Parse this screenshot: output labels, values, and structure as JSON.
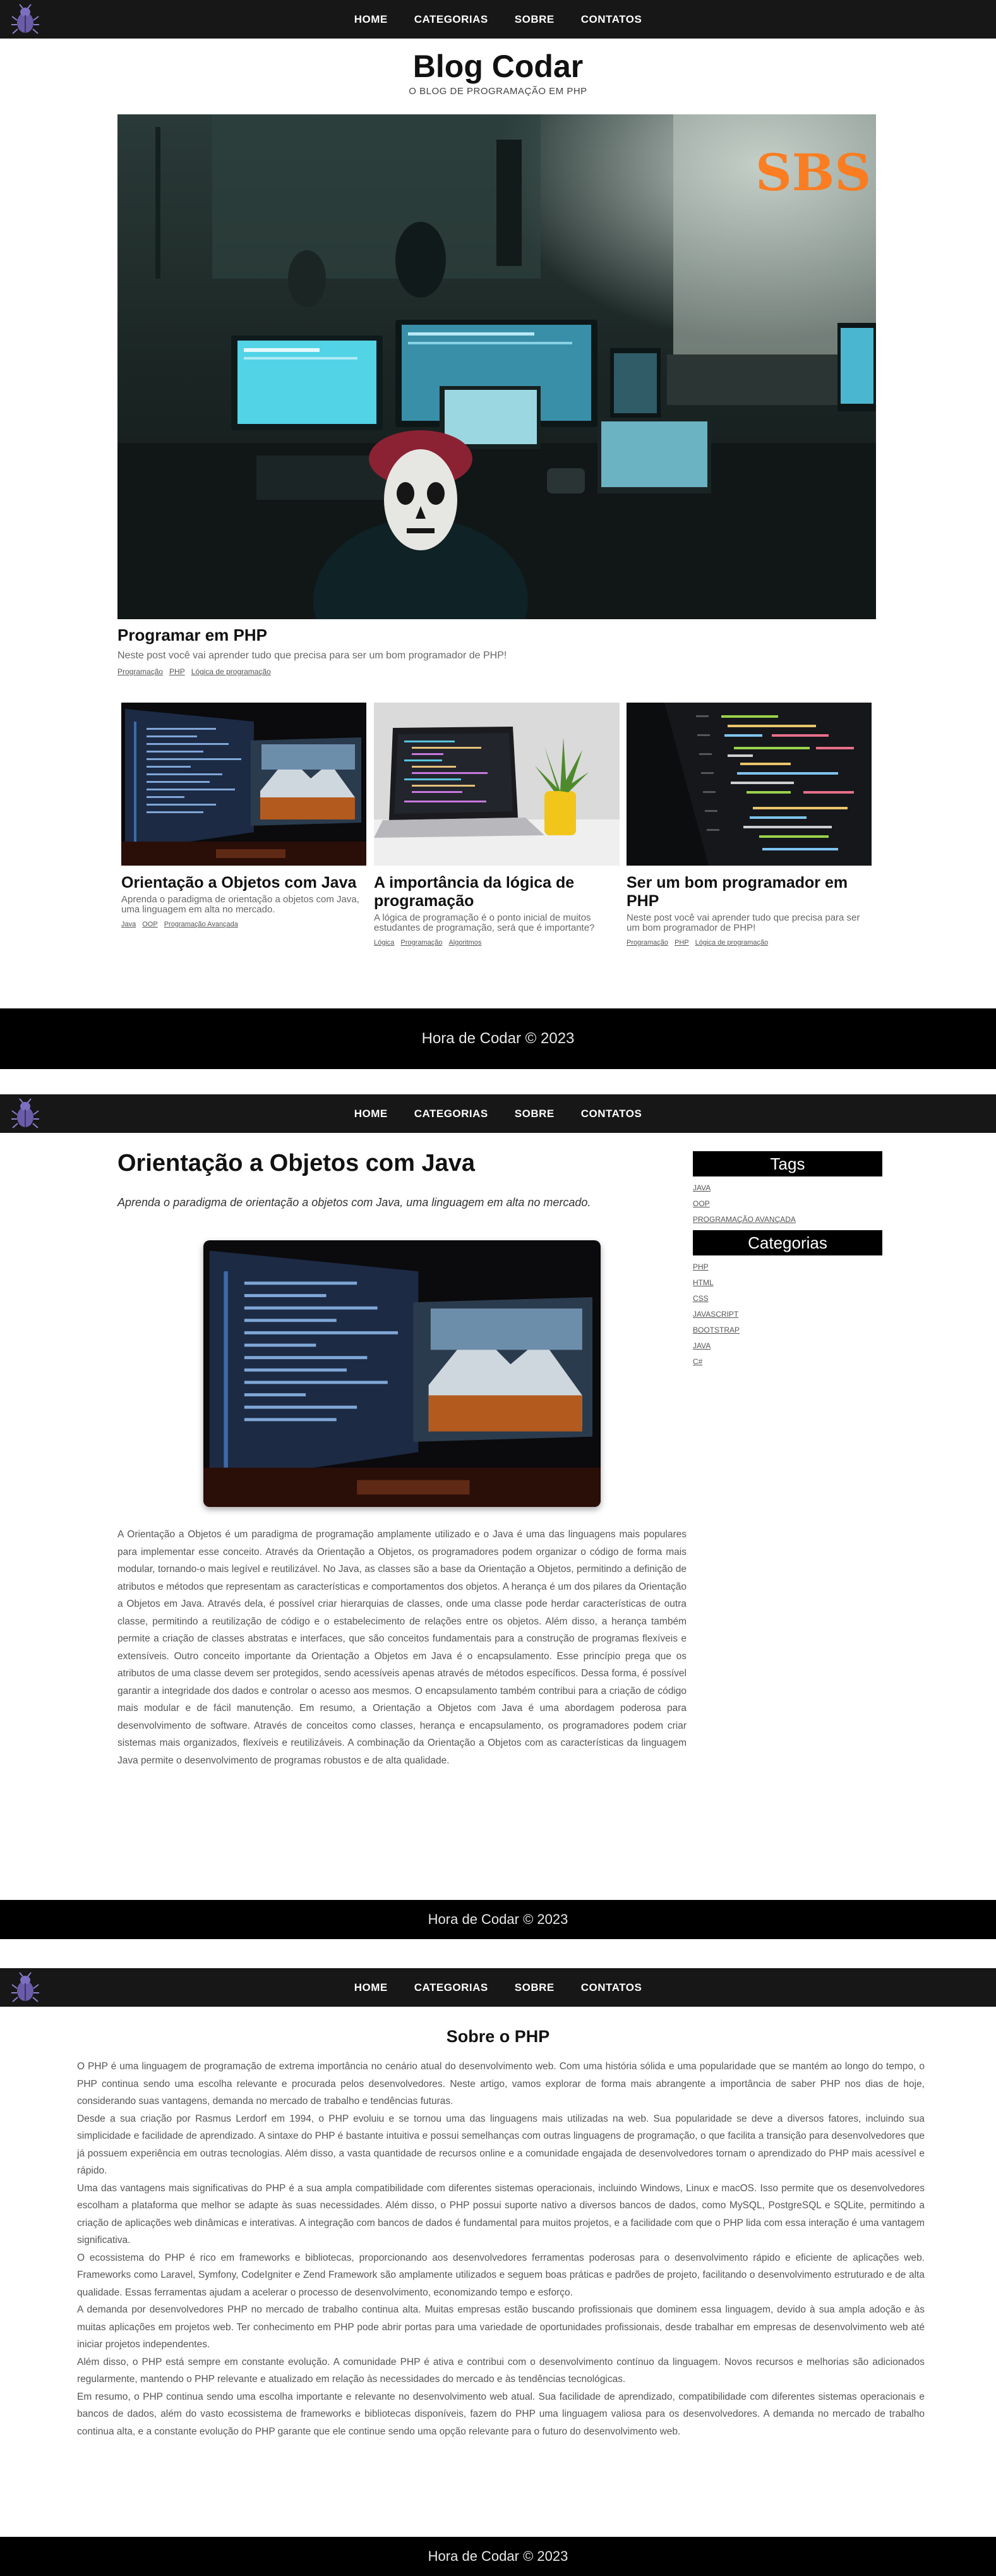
{
  "nav": {
    "links": [
      "HOME",
      "CATEGORIAS",
      "SOBRE",
      "CONTATOS"
    ]
  },
  "home": {
    "title": "Blog Codar",
    "subtitle": "O BLOG DE PROGRAMAÇÃO EM PHP",
    "featured": {
      "title": "Programar em PHP",
      "excerpt": "Neste post você vai aprender tudo que precisa para ser um bom programador de PHP!",
      "tags": [
        "Programação",
        "PHP",
        "Lógica de programação"
      ]
    },
    "posts": [
      {
        "title": "Orientação a Objetos com Java",
        "excerpt": "Aprenda o paradigma de orientação a objetos com Java, uma linguagem em alta no mercado.",
        "tags": [
          "Java",
          "OOP",
          "Programação Avançada"
        ]
      },
      {
        "title": "A importância da lógica de programação",
        "excerpt": "A lógica de programação é o ponto inicial de muitos estudantes de programação, será que é importante?",
        "tags": [
          "Lógica",
          "Programação",
          "Algoritmos"
        ]
      },
      {
        "title": "Ser um bom programador em PHP",
        "excerpt": "Neste post você vai aprender tudo que precisa para ser um bom programador de PHP!",
        "tags": [
          "Programação",
          "PHP",
          "Lógica de programação"
        ]
      }
    ],
    "footer": "Hora de Codar © 2023"
  },
  "article": {
    "title": "Orientação a Objetos com Java",
    "subtitle": "Aprenda o paradigma de orientação a objetos com Java, uma linguagem em alta no mercado.",
    "body": "A Orientação a Objetos é um paradigma de programação amplamente utilizado e o Java é uma das linguagens mais populares para implementar esse conceito. Através da Orientação a Objetos, os programadores podem organizar o código de forma mais modular, tornando-o mais legível e reutilizável. No Java, as classes são a base da Orientação a Objetos, permitindo a definição de atributos e métodos que representam as características e comportamentos dos objetos. A herança é um dos pilares da Orientação a Objetos em Java. Através dela, é possível criar hierarquias de classes, onde uma classe pode herdar características de outra classe, permitindo a reutilização de código e o estabelecimento de relações entre os objetos. Além disso, a herança também permite a criação de classes abstratas e interfaces, que são conceitos fundamentais para a construção de programas flexíveis e extensíveis. Outro conceito importante da Orientação a Objetos em Java é o encapsulamento. Esse princípio prega que os atributos de uma classe devem ser protegidos, sendo acessíveis apenas através de métodos específicos. Dessa forma, é possível garantir a integridade dos dados e controlar o acesso aos mesmos. O encapsulamento também contribui para a criação de código mais modular e de fácil manutenção. Em resumo, a Orientação a Objetos com Java é uma abordagem poderosa para desenvolvimento de software. Através de conceitos como classes, herança e encapsulamento, os programadores podem criar sistemas mais organizados, flexíveis e reutilizáveis. A combinação da Orientação a Objetos com as características da linguagem Java permite o desenvolvimento de programas robustos e de alta qualidade.",
    "sidebar": {
      "tags_title": "Tags",
      "tags": [
        "JAVA",
        "OOP",
        "PROGRAMAÇÃO AVANÇADA"
      ],
      "categories_title": "Categorias",
      "categories": [
        "PHP",
        "HTML",
        "CSS",
        "JAVASCRIPT",
        "BOOTSTRAP",
        "JAVA",
        "C#"
      ]
    },
    "footer": "Hora de Codar © 2023"
  },
  "about": {
    "title": "Sobre o PHP",
    "paragraphs": [
      "O PHP é uma linguagem de programação de extrema importância no cenário atual do desenvolvimento web. Com uma história sólida e uma popularidade que se mantém ao longo do tempo, o PHP continua sendo uma escolha relevante e procurada pelos desenvolvedores. Neste artigo, vamos explorar de forma mais abrangente a importância de saber PHP nos dias de hoje, considerando suas vantagens, demanda no mercado de trabalho e tendências futuras.",
      "Desde a sua criação por Rasmus Lerdorf em 1994, o PHP evoluiu e se tornou uma das linguagens mais utilizadas na web. Sua popularidade se deve a diversos fatores, incluindo sua simplicidade e facilidade de aprendizado. A sintaxe do PHP é bastante intuitiva e possui semelhanças com outras linguagens de programação, o que facilita a transição para desenvolvedores que já possuem experiência em outras tecnologias. Além disso, a vasta quantidade de recursos online e a comunidade engajada de desenvolvedores tornam o aprendizado do PHP mais acessível e rápido.",
      "Uma das vantagens mais significativas do PHP é a sua ampla compatibilidade com diferentes sistemas operacionais, incluindo Windows, Linux e macOS. Isso permite que os desenvolvedores escolham a plataforma que melhor se adapte às suas necessidades. Além disso, o PHP possui suporte nativo a diversos bancos de dados, como MySQL, PostgreSQL e SQLite, permitindo a criação de aplicações web dinâmicas e interativas. A integração com bancos de dados é fundamental para muitos projetos, e a facilidade com que o PHP lida com essa interação é uma vantagem significativa.",
      "O ecossistema do PHP é rico em frameworks e bibliotecas, proporcionando aos desenvolvedores ferramentas poderosas para o desenvolvimento rápido e eficiente de aplicações web. Frameworks como Laravel, Symfony, CodeIgniter e Zend Framework são amplamente utilizados e seguem boas práticas e padrões de projeto, facilitando o desenvolvimento estruturado e de alta qualidade. Essas ferramentas ajudam a acelerar o processo de desenvolvimento, economizando tempo e esforço.",
      "A demanda por desenvolvedores PHP no mercado de trabalho continua alta. Muitas empresas estão buscando profissionais que dominem essa linguagem, devido à sua ampla adoção e às muitas aplicações em projetos web. Ter conhecimento em PHP pode abrir portas para uma variedade de oportunidades profissionais, desde trabalhar em empresas de desenvolvimento web até iniciar projetos independentes.",
      "Além disso, o PHP está sempre em constante evolução. A comunidade PHP é ativa e contribui com o desenvolvimento contínuo da linguagem. Novos recursos e melhorias são adicionados regularmente, mantendo o PHP relevante e atualizado em relação às necessidades do mercado e às tendências tecnológicas.",
      "Em resumo, o PHP continua sendo uma escolha importante e relevante no desenvolvimento web atual. Sua facilidade de aprendizado, compatibilidade com diferentes sistemas operacionais e bancos de dados, além do vasto ecossistema de frameworks e bibliotecas disponíveis, fazem do PHP uma linguagem valiosa para os desenvolvedores. A demanda no mercado de trabalho continua alta, e a constante evolução do PHP garante que ele continue sendo uma opção relevante para o futuro do desenvolvimento web."
    ],
    "footer": "Hora de Codar © 2023"
  },
  "icons": {
    "logo": "bug-icon"
  },
  "colors": {
    "nav_bg": "#171717",
    "footer_bg": "#000000",
    "logo": "#6b5ca8"
  }
}
